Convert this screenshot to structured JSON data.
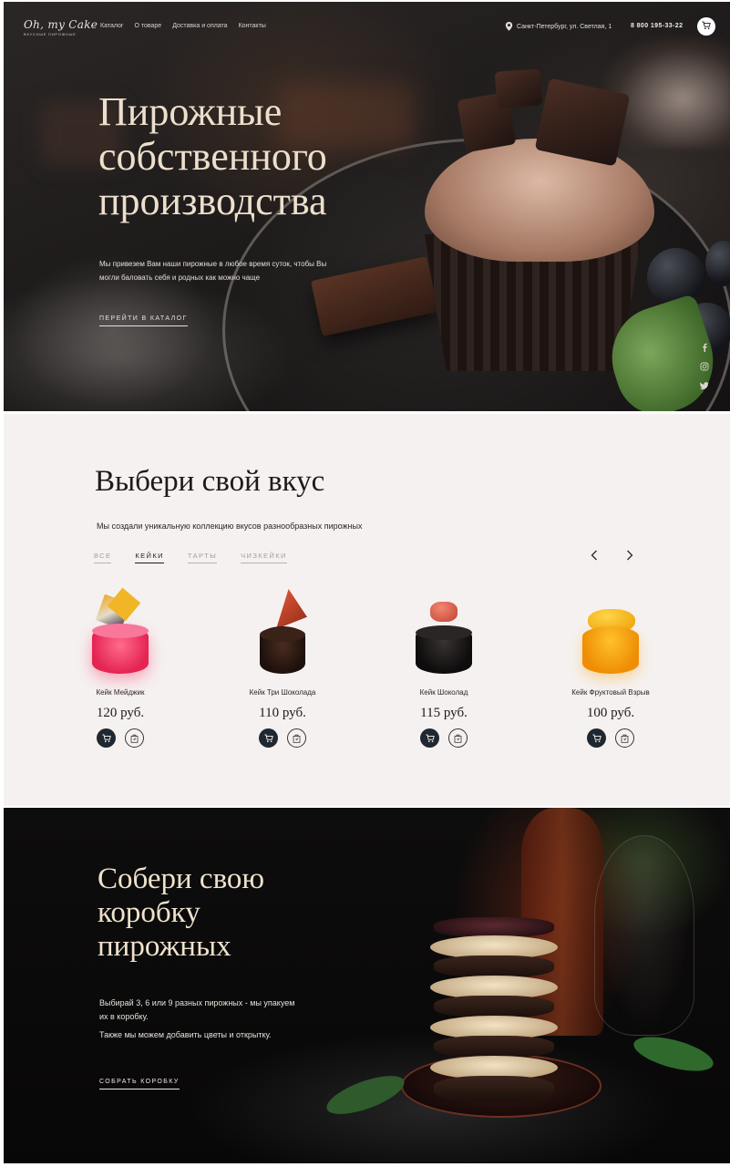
{
  "header": {
    "logo": "Oh, my Cake",
    "logo_tagline": "вкусные пирожные",
    "nav": [
      "Каталог",
      "О товаре",
      "Доставка и оплата",
      "Контакты"
    ],
    "location": "Санкт-Петербург, ул. Светлая, 1",
    "phone": "8 800 195-33-22"
  },
  "hero": {
    "title": "Пирожные собственного производства",
    "subtitle": "Мы привезем Вам наши пирожные в любое время суток, чтобы Вы могли баловать себя и родных как можно чаще",
    "cta": "Перейти в каталог"
  },
  "social": [
    "facebook-icon",
    "instagram-icon",
    "twitter-icon"
  ],
  "catalog": {
    "title": "Выбери свой вкус",
    "subtitle": "Мы создали уникальную коллекцию вкусов разнообразных пирожных",
    "tabs": [
      {
        "label": "Все",
        "active": false
      },
      {
        "label": "Кейки",
        "active": true
      },
      {
        "label": "Тарты",
        "active": false
      },
      {
        "label": "Чизкейки",
        "active": false
      }
    ],
    "products": [
      {
        "name": "Кейк Мейджик",
        "price": "120 руб.",
        "color": "#f0486e"
      },
      {
        "name": "Кейк Три Шоколада",
        "price": "110 руб.",
        "color": "#2a1a14"
      },
      {
        "name": "Кейк Шоколад",
        "price": "115 руб.",
        "color": "#1a1616"
      },
      {
        "name": "Кейк Фруктовый Взрыв",
        "price": "100 руб.",
        "color": "#f5a40f"
      }
    ]
  },
  "box_section": {
    "title": "Собери свою коробку пирожных",
    "text1": "Выбирай 3, 6 или 9 разных пирожных - мы упакуем их в коробку.",
    "text2": "Также мы можем добавить цветы и открытку.",
    "cta": "Собрать коробку"
  },
  "colors": {
    "hero_title": "#ecdfcc",
    "catalog_bg": "#f5f1f0",
    "button_dark": "#1f2730"
  }
}
